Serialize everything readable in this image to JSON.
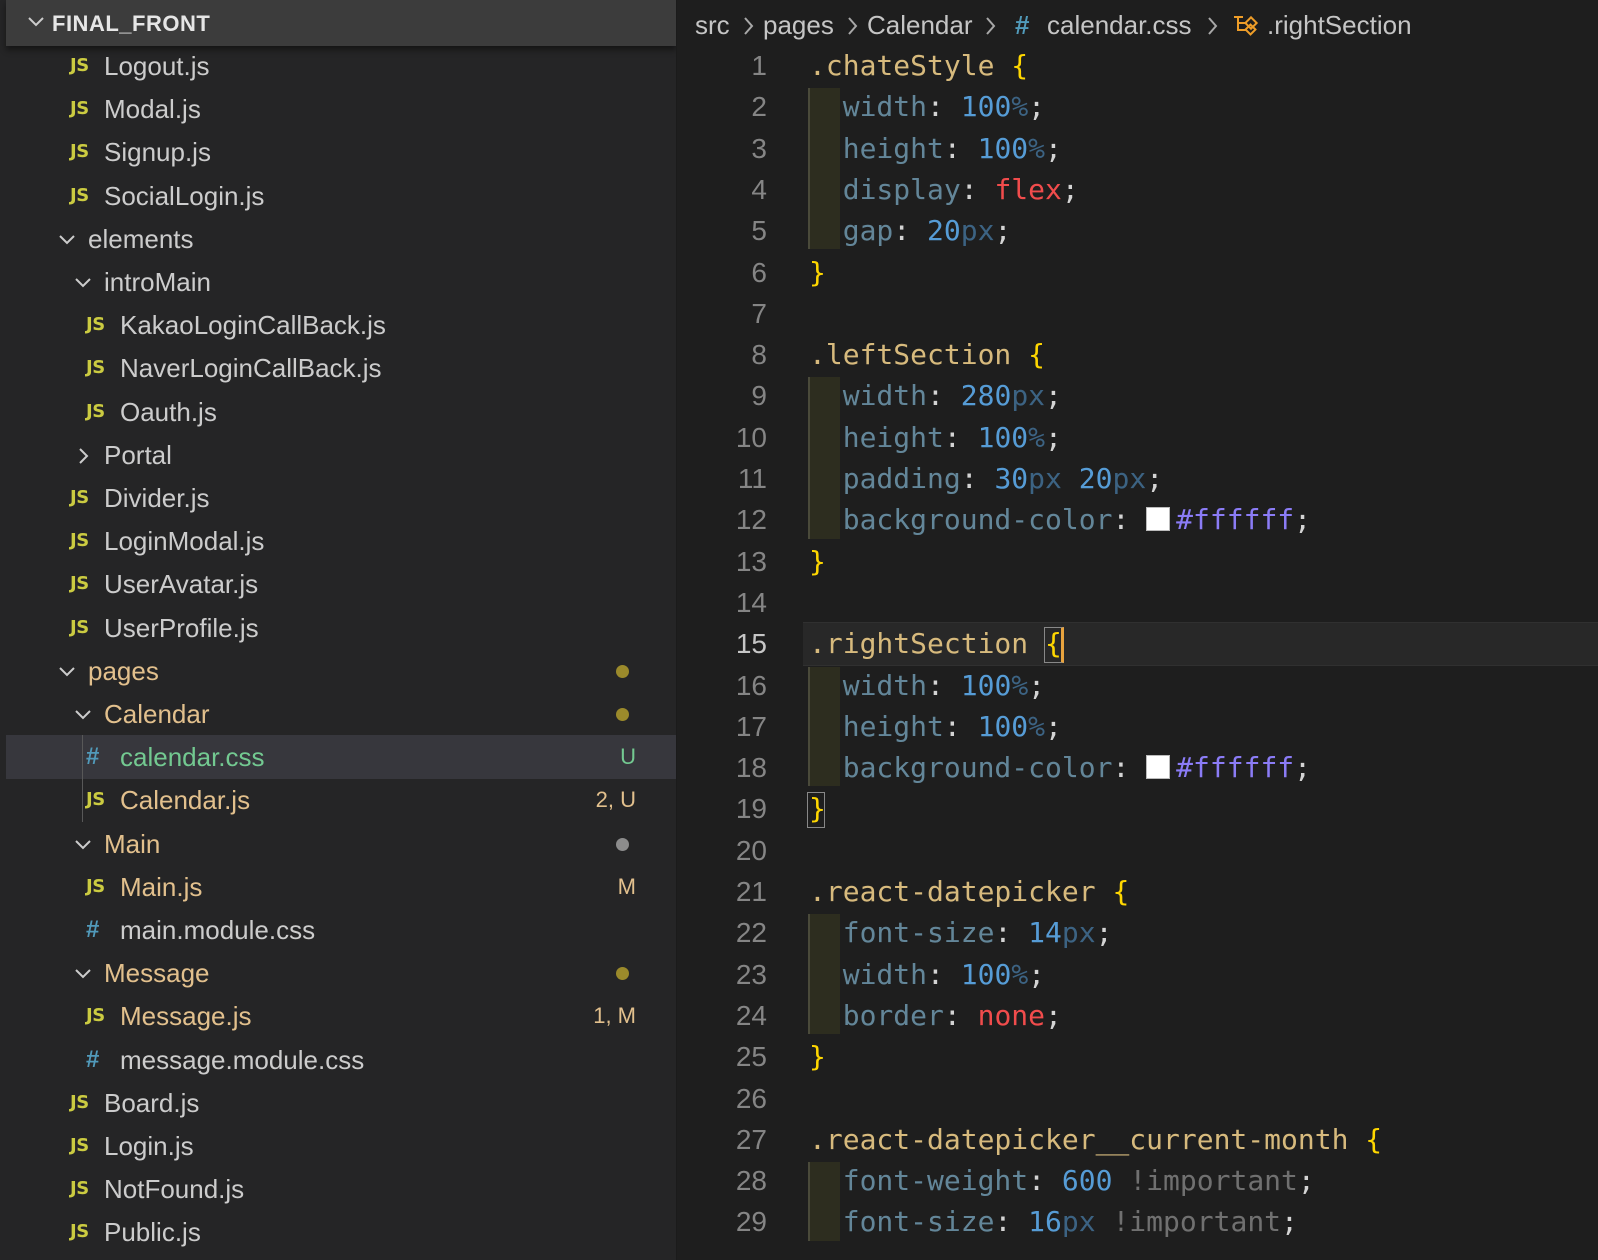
{
  "explorer": {
    "title": "FINAL_FRONT",
    "items": [
      {
        "label": "Logout.js",
        "type": "js"
      },
      {
        "label": "Modal.js",
        "type": "js"
      },
      {
        "label": "Signup.js",
        "type": "js"
      },
      {
        "label": "SocialLogin.js",
        "type": "js"
      },
      {
        "label": "elements",
        "type": "folder-open"
      },
      {
        "label": "introMain",
        "type": "folder-open"
      },
      {
        "label": "KakaoLoginCallBack.js",
        "type": "js"
      },
      {
        "label": "NaverLoginCallBack.js",
        "type": "js"
      },
      {
        "label": "Oauth.js",
        "type": "js"
      },
      {
        "label": "Portal",
        "type": "folder-closed"
      },
      {
        "label": "Divider.js",
        "type": "js"
      },
      {
        "label": "LoginModal.js",
        "type": "js"
      },
      {
        "label": "UserAvatar.js",
        "type": "js"
      },
      {
        "label": "UserProfile.js",
        "type": "js"
      },
      {
        "label": "pages",
        "type": "folder-open",
        "status": "dot-modified"
      },
      {
        "label": "Calendar",
        "type": "folder-open",
        "status": "dot-modified"
      },
      {
        "label": "calendar.css",
        "type": "css",
        "badge": "U",
        "selected": true
      },
      {
        "label": "Calendar.js",
        "type": "js",
        "badge": "2, U"
      },
      {
        "label": "Main",
        "type": "folder-open",
        "status": "dot-gray"
      },
      {
        "label": "Main.js",
        "type": "js",
        "badge": "M"
      },
      {
        "label": "main.module.css",
        "type": "css"
      },
      {
        "label": "Message",
        "type": "folder-open",
        "status": "dot-modified"
      },
      {
        "label": "Message.js",
        "type": "js",
        "badge": "1, M"
      },
      {
        "label": "message.module.css",
        "type": "css"
      },
      {
        "label": "Board.js",
        "type": "js"
      },
      {
        "label": "Login.js",
        "type": "js"
      },
      {
        "label": "NotFound.js",
        "type": "js"
      },
      {
        "label": "Public.js",
        "type": "js"
      }
    ]
  },
  "breadcrumb": [
    "src",
    "pages",
    "Calendar",
    "calendar.css",
    ".rightSection"
  ],
  "editor": {
    "file": "calendar.css",
    "active_line": 15,
    "lines": [
      ".chateStyle {",
      "  width: 100%;",
      "  height: 100%;",
      "  display: flex;",
      "  gap: 20px;",
      "}",
      "",
      ".leftSection {",
      "  width: 280px;",
      "  height: 100%;",
      "  padding: 30px 20px;",
      "  background-color: #ffffff;",
      "}",
      "",
      ".rightSection {",
      "  width: 100%;",
      "  height: 100%;",
      "  background-color: #ffffff;",
      "}",
      "",
      ".react-datepicker {",
      "  font-size: 14px;",
      "  width: 100%;",
      "  border: none;",
      "}",
      "",
      ".react-datepicker__current-month {",
      "  font-weight: 600 !important;",
      "  font-size: 16px !important;"
    ]
  },
  "colors": {
    "js_icon": "#cbcb41",
    "css_icon": "#519aba",
    "modified": "#e2c08d",
    "untracked": "#73c991",
    "selector": "#d7ba7d",
    "brace": "#ffd700",
    "number": "#569cd6",
    "keyword": "#f14c4c",
    "hex_value": "#8b7cf6"
  }
}
